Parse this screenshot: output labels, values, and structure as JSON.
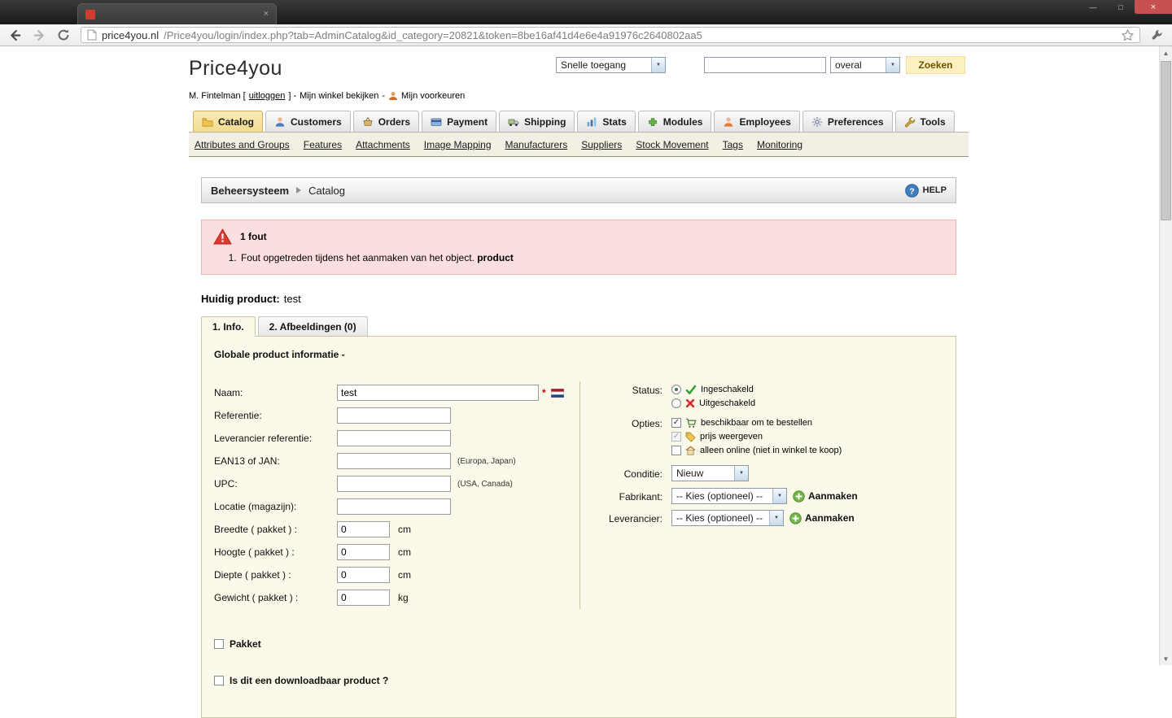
{
  "browser": {
    "url_domain": "price4you.nl",
    "url_path": "/Price4you/login/index.php?tab=AdminCatalog&id_category=20821&token=8be16af41d4e6e4a91976c2640802aa5"
  },
  "icons": {
    "chevron_down": "▼",
    "scroll_up": "▲",
    "scroll_down": "▼",
    "window_min": "—",
    "window_max": "□",
    "window_close": "×",
    "tab_close": "×",
    "help_glyph": "?"
  },
  "colors": {
    "active_tab": "#F2DC90",
    "panel_bg": "#FBFAEA",
    "panel_border": "#CBC69B",
    "error_bg": "#FBDEDE",
    "help_blue": "#3E7FC1",
    "action_green": "#72B546",
    "close_red": "#C75050"
  },
  "header": {
    "logo": "Price4you",
    "user_prefix": "M. Fintelman [",
    "logout_link": "uitloggen",
    "user_mid": "] -",
    "shop_link": "Mijn winkel bekijken",
    "dash": "-",
    "preferences_link": "Mijn voorkeuren",
    "quick_access": "Snelle toegang",
    "search_value": "",
    "search_scope": "overal",
    "search_button": "Zoeken"
  },
  "tabs": [
    {
      "label": "Catalog"
    },
    {
      "label": "Customers"
    },
    {
      "label": "Orders"
    },
    {
      "label": "Payment"
    },
    {
      "label": "Shipping"
    },
    {
      "label": "Stats"
    },
    {
      "label": "Modules"
    },
    {
      "label": "Employees"
    },
    {
      "label": "Preferences"
    },
    {
      "label": "Tools"
    }
  ],
  "submenu": [
    "Attributes and Groups",
    "Features",
    "Attachments",
    "Image Mapping",
    "Manufacturers",
    "Suppliers",
    "Stock Movement",
    "Tags",
    "Monitoring"
  ],
  "breadcrumb": {
    "root": "Beheersysteem",
    "current": "Catalog",
    "help": "HELP"
  },
  "error": {
    "title": "1 fout",
    "message": "Fout opgetreden tijdens het aanmaken van het object.",
    "object": "product"
  },
  "product": {
    "label": "Huidig product:",
    "name": "test"
  },
  "product_tabs": [
    {
      "label": "1. Info."
    },
    {
      "label": "2. Afbeeldingen (0)"
    }
  ],
  "form": {
    "legend": "Globale product informatie -",
    "naam": {
      "label": "Naam:",
      "value": "test",
      "required": "*"
    },
    "referentie": {
      "label": "Referentie:",
      "value": ""
    },
    "leverancier_referentie": {
      "label": "Leverancier referentie:",
      "value": ""
    },
    "ean13": {
      "label": "EAN13 of JAN:",
      "value": "",
      "note": "(Europa, Japan)"
    },
    "upc": {
      "label": "UPC:",
      "value": "",
      "note": "(USA, Canada)"
    },
    "locatie": {
      "label": "Locatie (magazijn):",
      "value": ""
    },
    "breedte": {
      "label": "Breedte ( pakket ) :",
      "value": "0",
      "unit": "cm"
    },
    "hoogte": {
      "label": "Hoogte ( pakket ) :",
      "value": "0",
      "unit": "cm"
    },
    "diepte": {
      "label": "Diepte ( pakket ) :",
      "value": "0",
      "unit": "cm"
    },
    "gewicht": {
      "label": "Gewicht ( pakket ) :",
      "value": "0",
      "unit": "kg"
    },
    "status": {
      "label": "Status:",
      "enabled": "Ingeschakeld",
      "disabled": "Uitgeschakeld"
    },
    "opties": {
      "label": "Opties:",
      "available": "beschikbaar om te bestellen",
      "show_price": "prijs weergeven",
      "online_only": "alleen online (niet in winkel te koop)"
    },
    "conditie": {
      "label": "Conditie:",
      "value": "Nieuw"
    },
    "fabrikant": {
      "label": "Fabrikant:",
      "value": "-- Kies (optioneel) --",
      "action": "Aanmaken"
    },
    "leverancier": {
      "label": "Leverancier:",
      "value": "-- Kies (optioneel) --",
      "action": "Aanmaken"
    },
    "pakket": {
      "label": "Pakket"
    },
    "downloadable": {
      "label": "Is dit een downloadbaar product ?"
    }
  }
}
